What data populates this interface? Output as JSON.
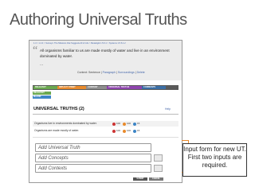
{
  "slide_title": "Authoring Universal Truths",
  "breadcrumb": "1.4 > 1.4.4 > Surveys: The Missions that Suggests All of Life > Metalogik 1.5.6.1 > Systems 1.5.6.1.2",
  "statement": "All organisms familiar to us are made mostly of water and live in an environment dominated by water.",
  "ellipsis": "...",
  "meta": {
    "prefix": "Context: Sentence |",
    "links": [
      "Paragraph",
      "Surroundings",
      "Delete"
    ]
  },
  "tabs": [
    "RELEVANT",
    "IMPLICIT STMNT",
    "CONTENT",
    "UNIVERSAL TRUTHS",
    "COMMENTS"
  ],
  "subtabs": [
    "RELEVANT",
    "MAJOR"
  ],
  "panel": {
    "title": "UNIVERSAL TRUTHS (2)",
    "help": "Help"
  },
  "truths": [
    {
      "text": "Organisms live in environments dominated by water.",
      "votes": [
        "100",
        "100",
        "15"
      ]
    },
    {
      "text": "Organisms are made mostly of water.",
      "votes": [
        "100",
        "100",
        "15"
      ]
    }
  ],
  "inputs": {
    "truth_placeholder": "Add Universal Truth",
    "concepts_placeholder": "Add Concepts",
    "contexts_placeholder": "Add Contexts"
  },
  "buttons": {
    "submit": "SUBMIT",
    "cancel": "CANCEL"
  },
  "callout": "Input form for new UT. First two inputs are required.",
  "colors": {
    "accent": "#e88a2c",
    "tab_green": "#6aa84f",
    "tab_purple": "#8e44ad",
    "tab_blue": "#3b6ea5"
  }
}
